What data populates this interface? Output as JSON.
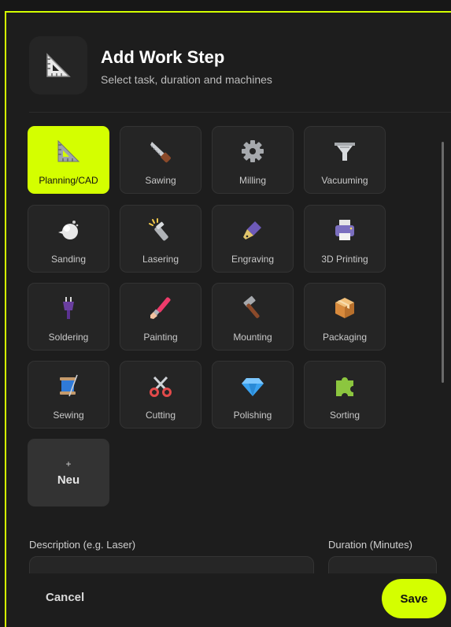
{
  "header": {
    "title": "Add Work Step",
    "subtitle": "Select task, duration and machines",
    "icon": "triangle-ruler-icon"
  },
  "tasks": [
    {
      "label": "Planning/CAD",
      "icon": "triangle-ruler-icon",
      "selected": true
    },
    {
      "label": "Sawing",
      "icon": "saw-icon",
      "selected": false
    },
    {
      "label": "Milling",
      "icon": "gear-icon",
      "selected": false
    },
    {
      "label": "Vacuuming",
      "icon": "funnel-icon",
      "selected": false
    },
    {
      "label": "Sanding",
      "icon": "sanding-icon",
      "selected": false
    },
    {
      "label": "Lasering",
      "icon": "flashlight-icon",
      "selected": false
    },
    {
      "label": "Engraving",
      "icon": "fountain-pen-icon",
      "selected": false
    },
    {
      "label": "3D Printing",
      "icon": "printer-icon",
      "selected": false
    },
    {
      "label": "Soldering",
      "icon": "plug-icon",
      "selected": false
    },
    {
      "label": "Painting",
      "icon": "paintbrush-icon",
      "selected": false
    },
    {
      "label": "Mounting",
      "icon": "hammer-icon",
      "selected": false
    },
    {
      "label": "Packaging",
      "icon": "package-icon",
      "selected": false
    },
    {
      "label": "Sewing",
      "icon": "thread-spool-icon",
      "selected": false
    },
    {
      "label": "Cutting",
      "icon": "scissors-icon",
      "selected": false
    },
    {
      "label": "Polishing",
      "icon": "gem-icon",
      "selected": false
    },
    {
      "label": "Sorting",
      "icon": "puzzle-icon",
      "selected": false
    }
  ],
  "new_tile": {
    "plus": "+",
    "label": "Neu"
  },
  "form": {
    "description_label": "Description (e.g. Laser)",
    "description_value": "",
    "duration_label": "Duration (Minutes)",
    "duration_value": ""
  },
  "footer": {
    "cancel": "Cancel",
    "save": "Save"
  },
  "colors": {
    "accent": "#d4ff00",
    "background": "#1d1d1d",
    "tile": "#252525"
  }
}
